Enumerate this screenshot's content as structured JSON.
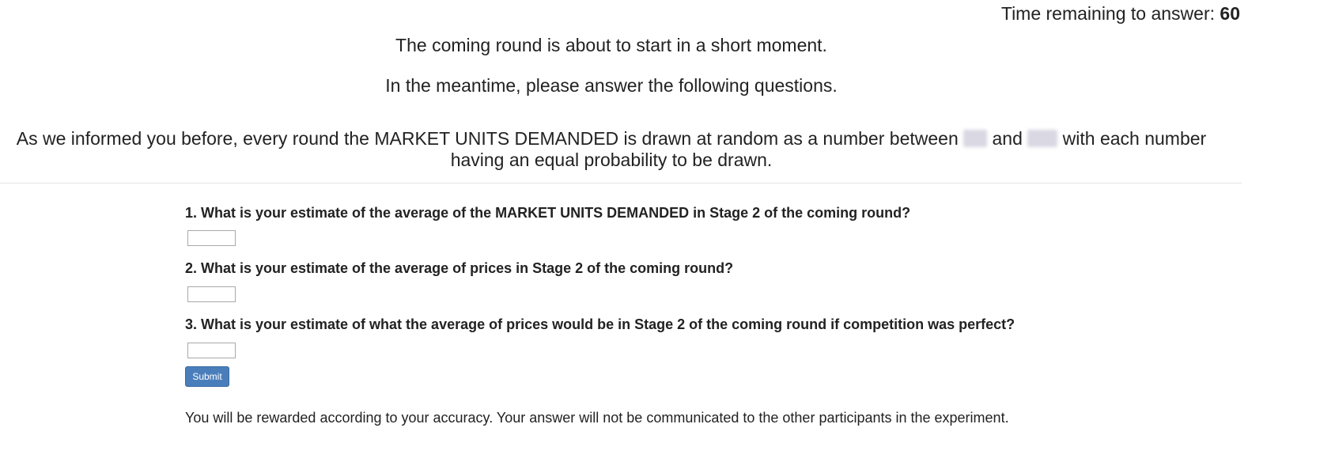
{
  "timer": {
    "label": "Time remaining to answer:",
    "seconds": "60"
  },
  "intro": {
    "line1": "The coming round is about to start in a short moment.",
    "line2": "In the meantime, please answer the following questions."
  },
  "info": {
    "part1": "As we informed you before, every round the MARKET UNITS DEMANDED is drawn at random as a number between",
    "part2": "and",
    "part3": "with each number having an equal probability to be drawn."
  },
  "questions": [
    {
      "label": "1. What is your estimate of the average of the MARKET UNITS DEMANDED in Stage 2 of the coming round?",
      "value": ""
    },
    {
      "label": "2. What is your estimate of the average of prices in Stage 2 of the coming round?",
      "value": ""
    },
    {
      "label": "3. What is your estimate of what the average of prices would be in Stage 2 of the coming round if competition was perfect?",
      "value": ""
    }
  ],
  "submit_label": "Submit",
  "reward_note": "You will be rewarded according to your accuracy. Your answer will not be communicated to the other participants in the experiment.",
  "colors": {
    "accent": "#4a7ebb",
    "text": "#222222",
    "redaction": "#d9d8e3"
  }
}
